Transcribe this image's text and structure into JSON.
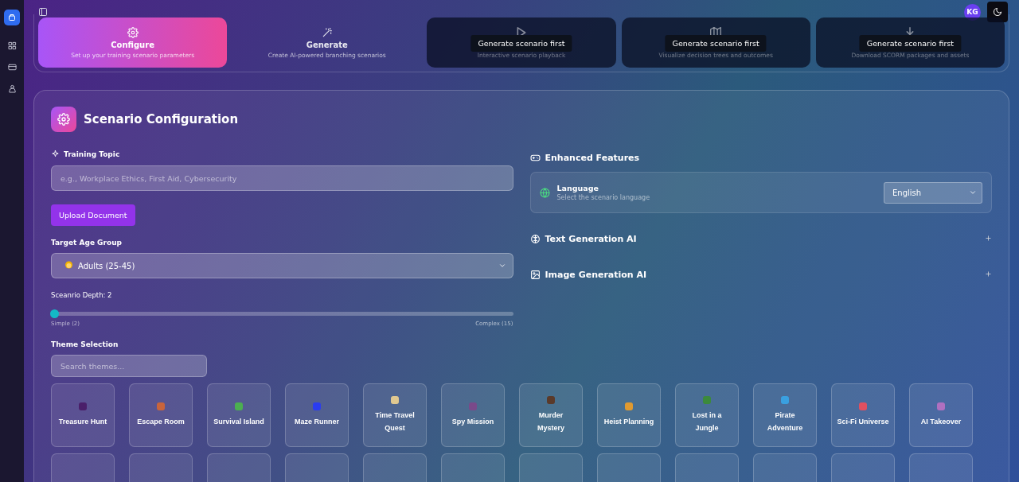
{
  "header": {
    "avatar": "KG"
  },
  "steps": [
    {
      "title": "Configure",
      "subtitle": "Set up your training scenario parameters",
      "selected": true,
      "disabled": false
    },
    {
      "title": "Generate",
      "subtitle": "Create AI-powered branching scenarios",
      "selected": false,
      "disabled": false
    },
    {
      "subtitle": "Interactive scenario playback",
      "tooltip": "Generate scenario first",
      "selected": false,
      "disabled": true
    },
    {
      "subtitle": "Visualize decision trees and outcomes",
      "tooltip": "Generate scenario first",
      "selected": false,
      "disabled": true
    },
    {
      "subtitle": "Download SCORM packages and assets",
      "tooltip": "Generate scenario first",
      "selected": false,
      "disabled": true
    }
  ],
  "config": {
    "title": "Scenario Configuration",
    "topic": {
      "label": "Training Topic",
      "placeholder": "e.g., Workplace Ethics, First Aid, Cybersecurity"
    },
    "upload_button": "Upload Document",
    "age_group": {
      "label": "Target Age Group",
      "value": "Adults (25-45)"
    },
    "depth": {
      "label": "Sceanrio Depth: 2",
      "level": 0,
      "min_label": "Simple (2)",
      "max_label": "Complex (15)"
    },
    "themes": {
      "label": "Theme Selection",
      "placeholder": "Search themes...",
      "items": [
        {
          "label": "Treasure Hunt",
          "color": "#4a1f6a"
        },
        {
          "label": "Escape Room",
          "color": "#c8643c"
        },
        {
          "label": "Survival Island",
          "color": "#4caf50"
        },
        {
          "label": "Maze Runner",
          "color": "#2a3cf0"
        },
        {
          "label": "Time Travel Quest",
          "color": "#e0c890"
        },
        {
          "label": "Spy Mission",
          "color": "#7a4a8a"
        },
        {
          "label": "Murder Mystery",
          "color": "#5a3a2a"
        },
        {
          "label": "Heist Planning",
          "color": "#e09a30"
        },
        {
          "label": "Lost in a Jungle",
          "color": "#3c8a3c"
        },
        {
          "label": "Pirate Adventure",
          "color": "#3aa0e0"
        },
        {
          "label": "Sci-Fi Universe",
          "color": "#e05060"
        },
        {
          "label": "AI Takeover",
          "color": "#b070c0"
        }
      ]
    },
    "features": {
      "title": "Enhanced Features",
      "language": {
        "label": "Language",
        "hint": "Select the scenario language",
        "value": "English"
      },
      "sections": [
        {
          "title": "Text Generation AI",
          "kind": "brain",
          "expanded": false
        },
        {
          "title": "Image Generation AI",
          "kind": "image",
          "expanded": false
        }
      ]
    }
  }
}
